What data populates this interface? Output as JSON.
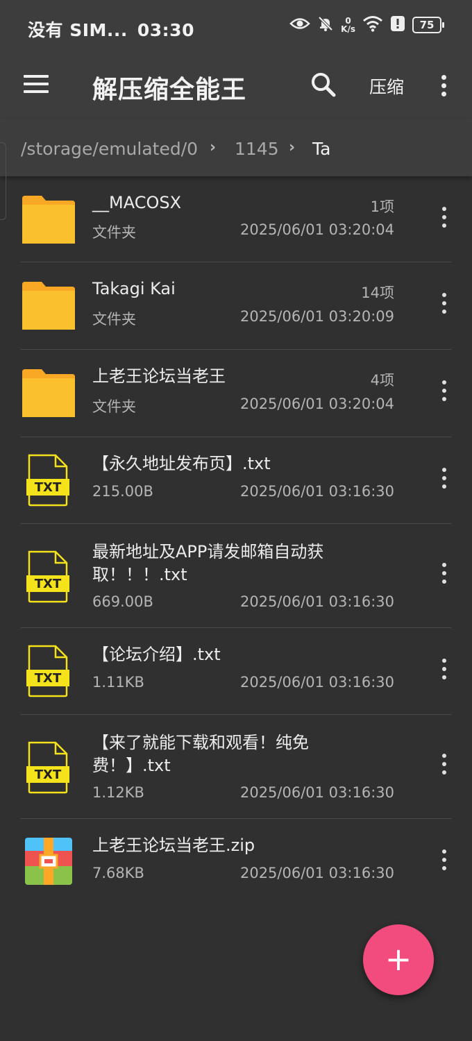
{
  "status_bar": {
    "carrier": "没有 SIM...",
    "time": "03:30",
    "net_speed_value": "0",
    "net_speed_unit": "K/s",
    "battery": "75",
    "icons": [
      "eye-icon",
      "bell-off-icon",
      "wifi-icon",
      "alert-icon",
      "battery-icon"
    ]
  },
  "appbar": {
    "title": "解压缩全能王",
    "compress_label": "压缩"
  },
  "breadcrumb": {
    "items": [
      "/storage/emulated/0",
      "1145",
      "Ta"
    ]
  },
  "files": [
    {
      "name": "__MACOSX",
      "type": "文件夹",
      "count": "1项",
      "date": "2025/06/01 03:20:04",
      "icon": "folder-icon"
    },
    {
      "name": "Takagi Kai",
      "type": "文件夹",
      "count": "14项",
      "date": "2025/06/01 03:20:09",
      "icon": "folder-icon"
    },
    {
      "name": "上老王论坛当老王",
      "type": "文件夹",
      "count": "4项",
      "date": "2025/06/01 03:20:04",
      "icon": "folder-icon"
    },
    {
      "name": "【永久地址发布页】.txt",
      "size": "215.00B",
      "date": "2025/06/01 03:16:30",
      "icon": "txt-file-icon",
      "icon_label": "TXT"
    },
    {
      "name": "最新地址及APP请发邮箱自动获取！！！.txt",
      "size": "669.00B",
      "date": "2025/06/01 03:16:30",
      "icon": "txt-file-icon",
      "icon_label": "TXT"
    },
    {
      "name": "【论坛介绍】.txt",
      "size": "1.11KB",
      "date": "2025/06/01 03:16:30",
      "icon": "txt-file-icon",
      "icon_label": "TXT"
    },
    {
      "name": "【来了就能下载和观看！纯免费！】.txt",
      "size": "1.12KB",
      "date": "2025/06/01 03:16:30",
      "icon": "txt-file-icon",
      "icon_label": "TXT"
    },
    {
      "name": "上老王论坛当老王.zip",
      "size": "7.68KB",
      "date": "2025/06/01 03:16:30",
      "icon": "zip-archive-icon"
    }
  ],
  "fab": {
    "label": "+"
  },
  "colors": {
    "background": "#303030",
    "bar": "#3d3d3d",
    "folder": "#fbc02d",
    "txt_badge": "#f4e21a",
    "fab": "#f24b7d"
  }
}
